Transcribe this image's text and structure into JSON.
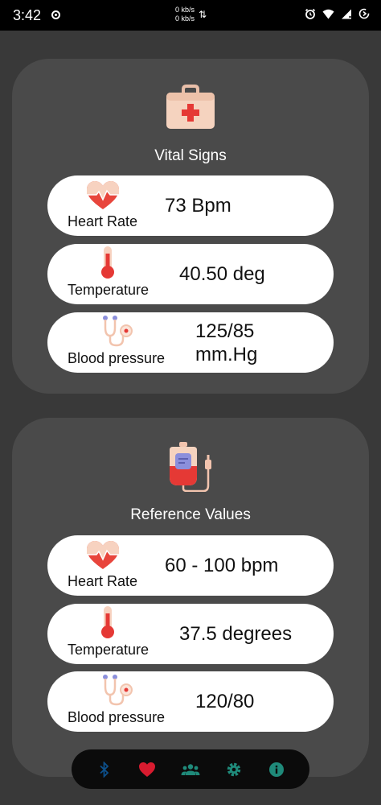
{
  "status": {
    "time": "3:42",
    "net_up": "0 kb/s",
    "net_down": "0 kb/s"
  },
  "vital_signs": {
    "title": "Vital Signs",
    "icon": "first-aid-kit-icon",
    "rows": [
      {
        "label": "Heart Rate",
        "value": "73 Bpm",
        "icon": "heart-icon"
      },
      {
        "label": "Temperature",
        "value": "40.50 deg",
        "icon": "thermometer-icon"
      },
      {
        "label": "Blood pressure",
        "value_line1": "125/85",
        "value_line2": "mm.Hg",
        "icon": "stethoscope-icon"
      }
    ]
  },
  "reference_values": {
    "title": "Reference Values",
    "icon": "blood-bag-icon",
    "rows": [
      {
        "label": "Heart Rate",
        "value": "60 - 100 bpm",
        "icon": "heart-icon"
      },
      {
        "label": "Temperature",
        "value": "37.5 degrees",
        "icon": "thermometer-icon"
      },
      {
        "label": "Blood pressure",
        "value": "120/80",
        "icon": "stethoscope-icon"
      }
    ]
  },
  "nav": {
    "items": [
      "bluetooth-icon",
      "heart-icon",
      "people-icon",
      "settings-icon",
      "info-icon"
    ],
    "active_index": 1,
    "colors": {
      "bluetooth": "#0d4f8a",
      "heart": "#d81b2f",
      "teal": "#1f8a7a"
    }
  }
}
